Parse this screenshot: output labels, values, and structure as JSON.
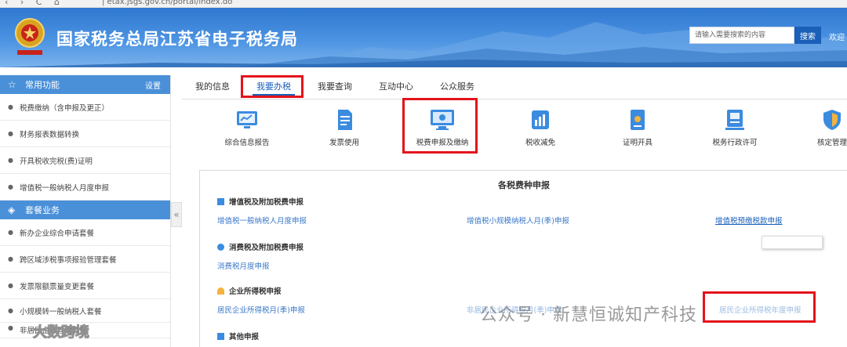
{
  "browser": {
    "nav_glyphs": "‹ › C ⌂",
    "url": "| etax.jsgs.gov.cn/portal/index.do"
  },
  "header": {
    "site_title": "国家税务总局江苏省电子税务局",
    "search_placeholder": "请输入需要搜索的内容",
    "search_button": "搜索",
    "welcome": "欢迎"
  },
  "sidebar": {
    "common_title": "常用功能",
    "settings_label": "设置",
    "common_items": [
      {
        "label": "税费缴纳（含申报及更正）"
      },
      {
        "label": "财务报表数据转换"
      },
      {
        "label": "开具税收完税(费)证明"
      },
      {
        "label": "增值税一般纳税人月度申报"
      }
    ],
    "package_title": "套餐业务",
    "package_items": [
      {
        "label": "新办企业综合申请套餐"
      },
      {
        "label": "跨区域涉税事项报验管理套餐"
      },
      {
        "label": "发票限额票量变更套餐"
      },
      {
        "label": "小规模转一般纳税人套餐"
      },
      {
        "label": "非居民企业管理套餐"
      }
    ],
    "collapse_glyph": "«"
  },
  "tabs": [
    {
      "label": "我的信息"
    },
    {
      "label": "我要办税"
    },
    {
      "label": "我要查询"
    },
    {
      "label": "互动中心"
    },
    {
      "label": "公众服务"
    }
  ],
  "functions": [
    {
      "label": "综合信息报告",
      "icon": "report-icon"
    },
    {
      "label": "发票使用",
      "icon": "invoice-icon"
    },
    {
      "label": "税费申报及缴纳",
      "icon": "monitor-icon"
    },
    {
      "label": "税收减免",
      "icon": "chart-icon"
    },
    {
      "label": "证明开具",
      "icon": "certificate-icon"
    },
    {
      "label": "税务行政许可",
      "icon": "license-icon"
    },
    {
      "label": "核定管理",
      "icon": "shield-icon"
    }
  ],
  "panel": {
    "title": "各税费种申报",
    "sections": [
      {
        "title": "增值税及附加税费申报",
        "links": [
          "增值税一般纳税人月度申报",
          "增值税小规模纳税人月(季)申报",
          "增值税预缴税款申报"
        ]
      },
      {
        "title": "消费税及附加税费申报",
        "links": [
          "消费税月度申报"
        ]
      },
      {
        "title": "企业所得税申报",
        "links": [
          "居民企业所得税月(季)申报",
          "非居民企业所得税月(季)申报",
          "居民企业所得税年度申报"
        ]
      },
      {
        "title": "其他申报",
        "links": []
      }
    ]
  },
  "watermarks": {
    "center": "公众号 · 新慧恒诚知产科技",
    "bottom_left": "大数跨境"
  },
  "colors": {
    "accent": "#1a5fb8",
    "sidebar_header": "#4a90d9",
    "highlight_red": "#e3141b",
    "link": "#3a78c8"
  }
}
